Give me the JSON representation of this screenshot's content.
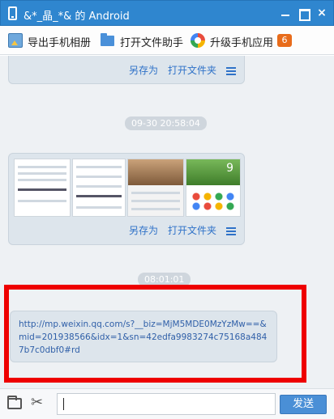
{
  "window": {
    "title": "&*_晶_*& 的 Android",
    "close_symbol": "×"
  },
  "toolbar": {
    "export_album": "导出手机相册",
    "open_file_helper": "打开文件助手",
    "upgrade_apps": "升级手机应用",
    "upgrade_badge": "6"
  },
  "chat": {
    "messages": [
      {
        "type": "file",
        "actions": [
          "另存为",
          "打开文件夹"
        ]
      },
      {
        "type": "timestamp",
        "text": "09-30 20:58:04"
      },
      {
        "type": "images",
        "actions": [
          "另存为",
          "打开文件夹"
        ],
        "thumb_badge": "9"
      },
      {
        "type": "timestamp",
        "text": "08:01:01"
      },
      {
        "type": "link",
        "text": "http://mp.weixin.qq.com/s?__biz=MjM5MDE0MzYzMw==&mid=201938566&idx=1&sn=42edfa9983274c75168a4847b7c0dbf0#rd"
      }
    ]
  },
  "input_bar": {
    "send_label": "发送"
  },
  "icons": {
    "window": "phone-icon",
    "export": "image-export-icon",
    "file_helper": "folder-icon",
    "upgrade": "app-store-icon",
    "attach": "folder-open-icon",
    "screenshot": "scissors-icon",
    "more": "menu-icon"
  },
  "colors": {
    "titlebar": "#2f86cf",
    "badge": "#e86c1b",
    "link": "#2f5fa8",
    "action": "#2f72c8",
    "highlight": "#ee0000",
    "send_button": "#4a8fd6"
  }
}
